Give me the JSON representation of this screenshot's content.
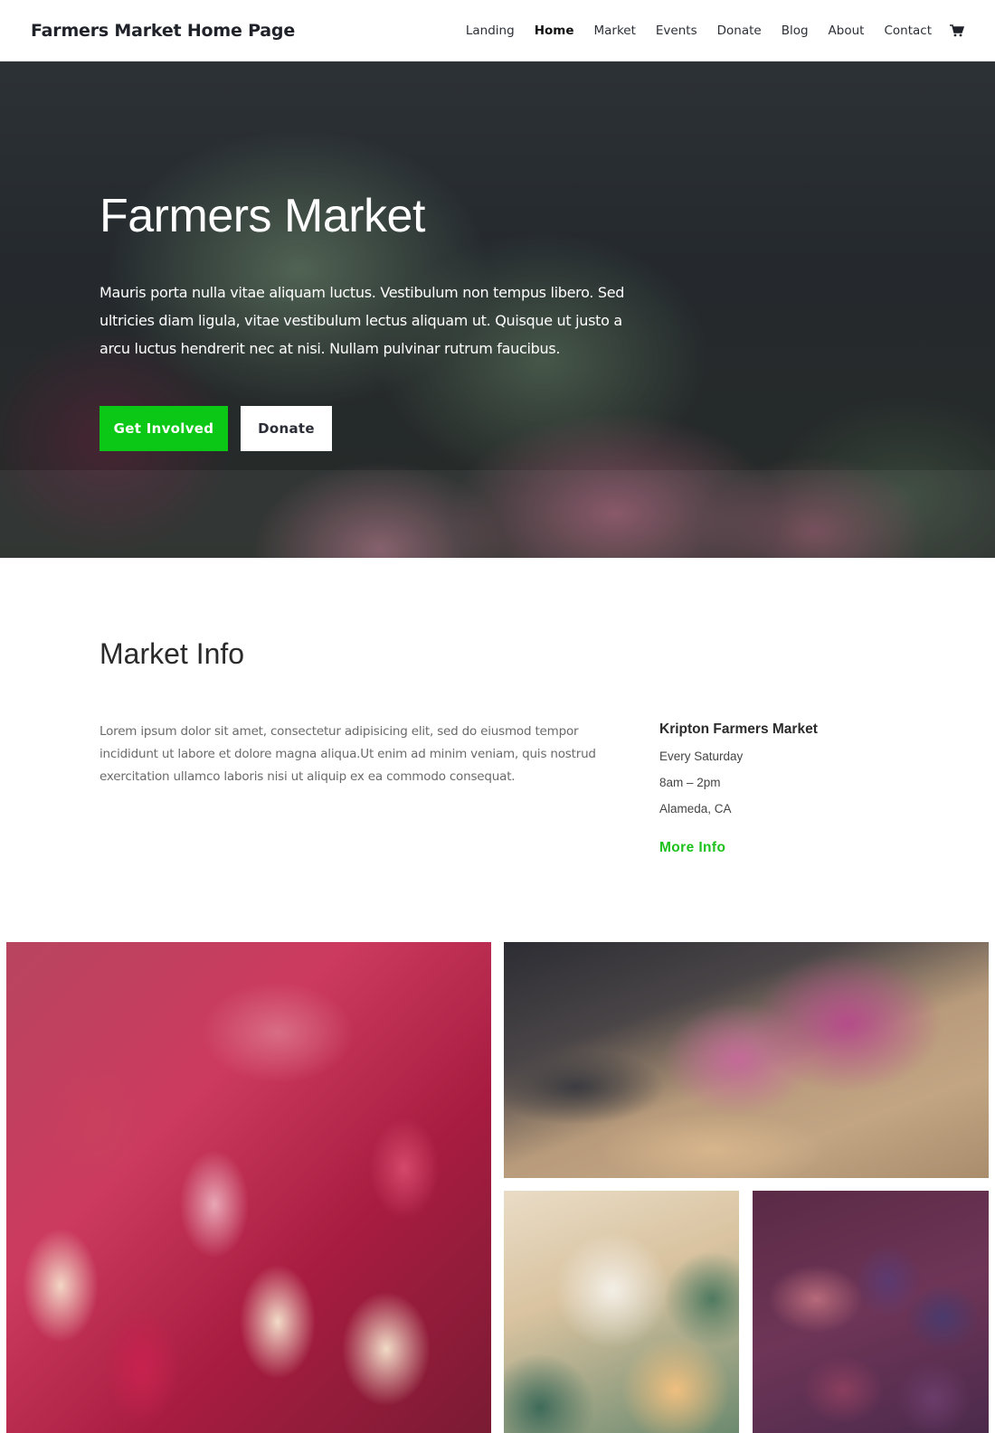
{
  "header": {
    "brand": "Farmers Market Home Page",
    "nav": [
      {
        "label": "Landing",
        "active": false
      },
      {
        "label": "Home",
        "active": true
      },
      {
        "label": "Market",
        "active": false
      },
      {
        "label": "Events",
        "active": false
      },
      {
        "label": "Donate",
        "active": false
      },
      {
        "label": "Blog",
        "active": false
      },
      {
        "label": "About",
        "active": false
      },
      {
        "label": "Contact",
        "active": false
      }
    ],
    "cart_icon": "shopping-cart-icon"
  },
  "hero": {
    "title": "Farmers Market",
    "text": "Mauris porta nulla vitae aliquam luctus. Vestibulum non tempus libero. Sed ultricies diam ligula, vitae vestibulum lectus aliquam ut. Quisque ut justo a arcu luctus hendrerit nec at nisi. Nullam pulvinar rutrum faucibus.",
    "primary_button": "Get Involved",
    "secondary_button": "Donate",
    "background_image": "radishes-at-market-photo"
  },
  "market_info": {
    "title": "Market Info",
    "text": "Lorem ipsum dolor sit amet, consectetur adipisicing elit, sed do eiusmod tempor incididunt ut labore et dolore magna aliqua.Ut enim ad minim veniam, quis nostrud exercitation ullamco laboris nisi ut aliquip ex ea commodo consequat.",
    "card": {
      "name": "Kripton Farmers Market",
      "day": "Every Saturday",
      "hours": "8am – 2pm",
      "location": "Alameda, CA",
      "link": "More Info"
    }
  },
  "gallery": {
    "images": [
      {
        "subject": "radishes-close-up-photo"
      },
      {
        "subject": "radishes-in-crate-photo"
      },
      {
        "subject": "melons-photo"
      },
      {
        "subject": "figs-photo"
      }
    ]
  },
  "colors": {
    "accent_green": "#0cc816",
    "link_green": "#1cc11c",
    "text_dark": "#1f2329"
  }
}
